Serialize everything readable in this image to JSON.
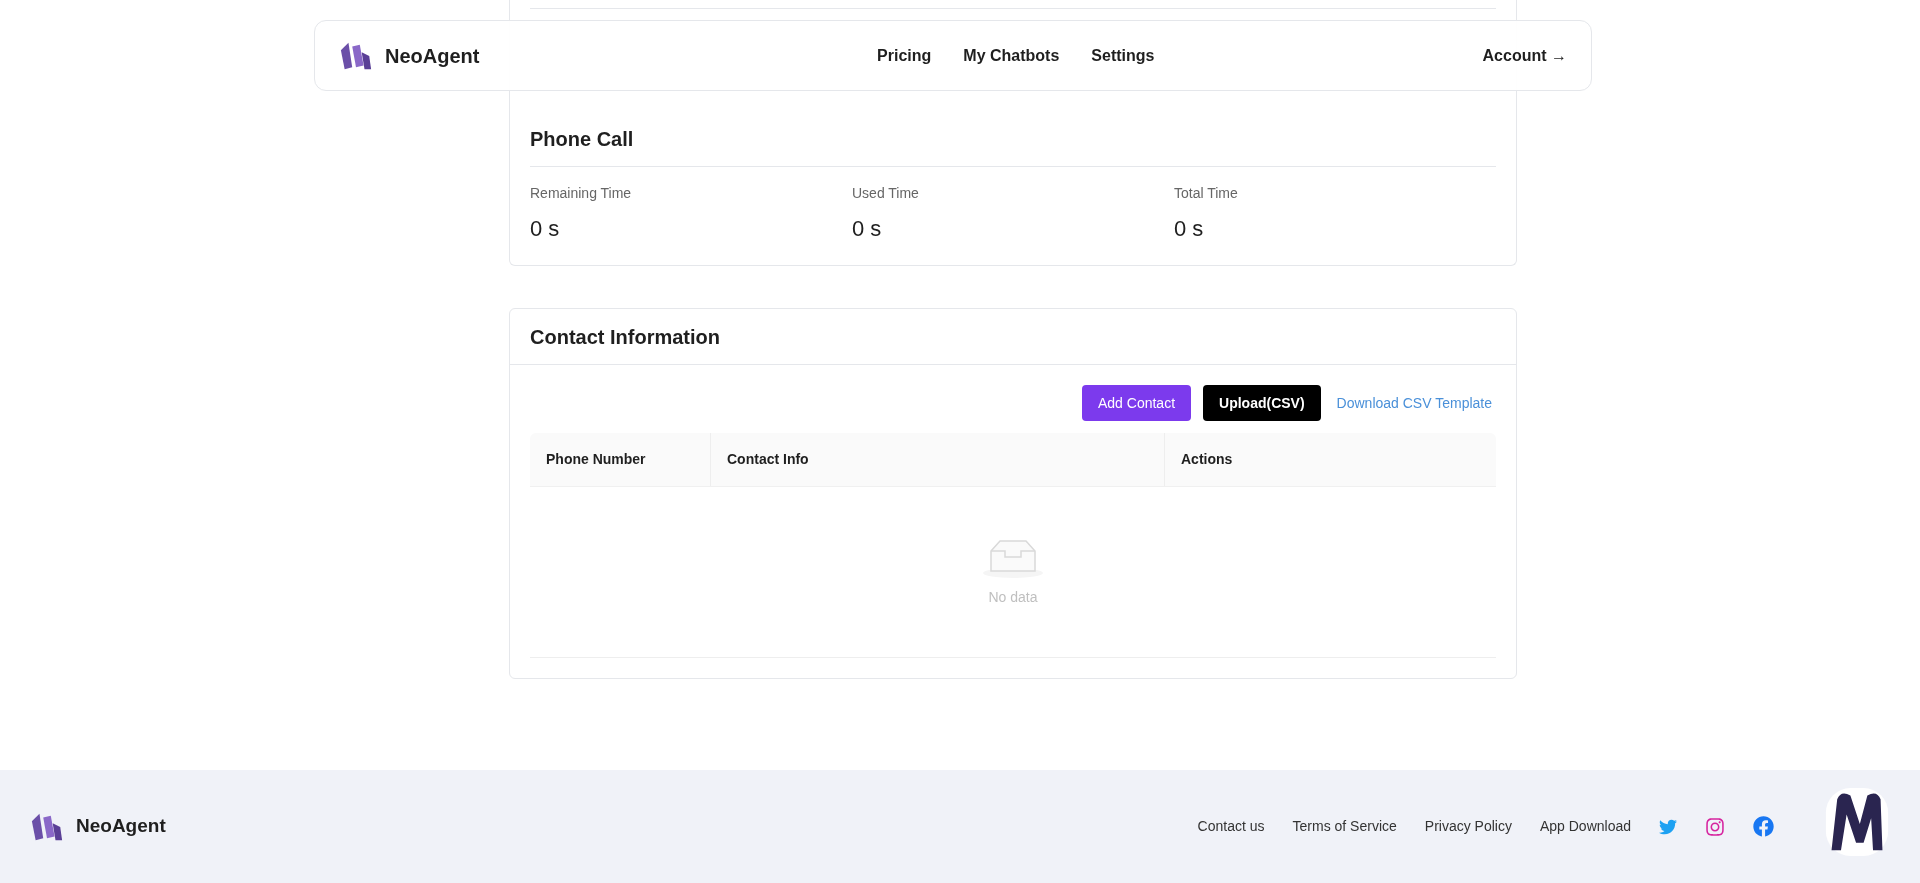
{
  "header": {
    "brand": "NeoAgent",
    "nav": [
      {
        "label": "Pricing"
      },
      {
        "label": "My Chatbots"
      },
      {
        "label": "Settings"
      }
    ],
    "account": "Account →"
  },
  "usage": {
    "title": "Phone Call",
    "stats": [
      {
        "label": "Remaining Time",
        "value": "0 s"
      },
      {
        "label": "Used Time",
        "value": "0 s"
      },
      {
        "label": "Total Time",
        "value": "0 s"
      }
    ]
  },
  "contacts": {
    "title": "Contact Information",
    "buttons": [
      {
        "label": "Add Contact",
        "kind": "primary"
      },
      {
        "label": "Upload(CSV)",
        "kind": "dark"
      },
      {
        "label": "Download CSV Template",
        "kind": "link"
      }
    ],
    "columns": [
      "Phone Number",
      "Contact Info",
      "Actions"
    ],
    "empty": "No data"
  },
  "footer": {
    "brand": "NeoAgent",
    "links": [
      "Contact us",
      "Terms of Service",
      "Privacy Policy",
      "App Download"
    ]
  }
}
